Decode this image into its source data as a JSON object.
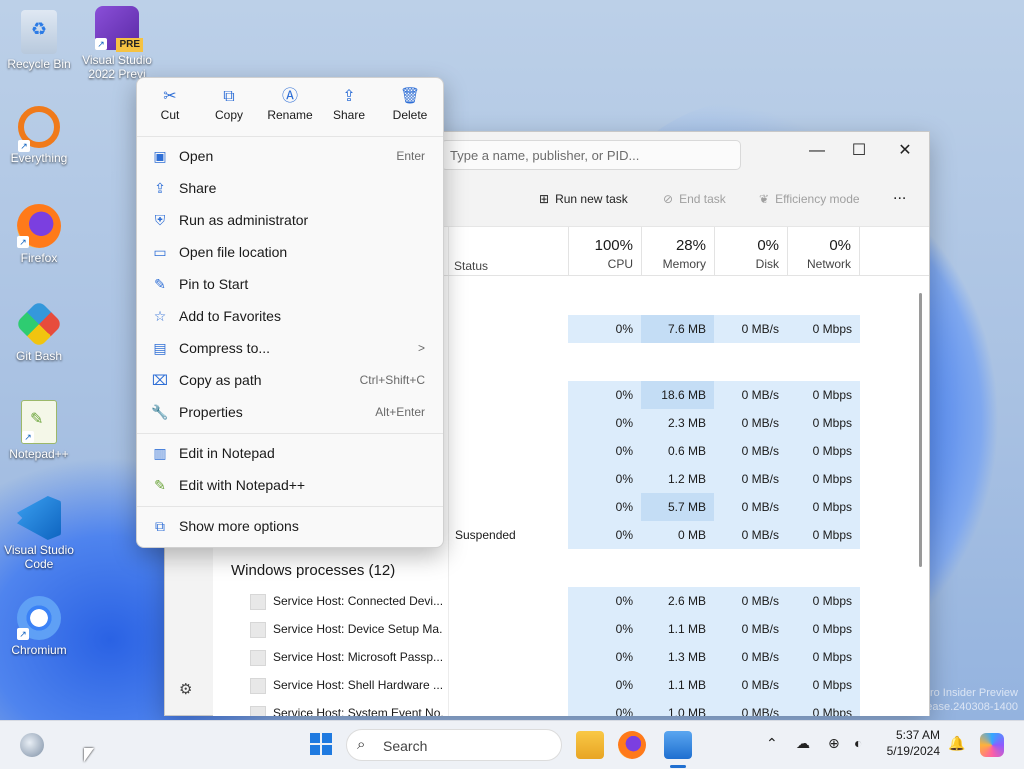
{
  "desktop": {
    "icons": [
      {
        "label": "Recycle Bin"
      },
      {
        "label": "Visual Studio 2022 Previ",
        "badge": "PRE"
      },
      {
        "label": "Everything"
      },
      {
        "label": "Firefox"
      },
      {
        "label": "Git Bash"
      },
      {
        "label": "Notepad++"
      },
      {
        "label": "Visual Studio Code"
      },
      {
        "label": "Chromium"
      }
    ],
    "watermark_line1": "ro Insider Preview",
    "watermark_line2": "ease.240308-1400"
  },
  "context_menu": {
    "actions": [
      {
        "label": "Cut",
        "icon": "cut-icon"
      },
      {
        "label": "Copy",
        "icon": "copy-icon"
      },
      {
        "label": "Rename",
        "icon": "rename-icon"
      },
      {
        "label": "Share",
        "icon": "share-icon"
      },
      {
        "label": "Delete",
        "icon": "delete-icon"
      }
    ],
    "items": [
      {
        "label": "Open",
        "shortcut": "Enter"
      },
      {
        "label": "Share",
        "shortcut": ""
      },
      {
        "label": "Run as administrator",
        "shortcut": ""
      },
      {
        "label": "Open file location",
        "shortcut": ""
      },
      {
        "label": "Pin to Start",
        "shortcut": ""
      },
      {
        "label": "Add to Favorites",
        "shortcut": ""
      },
      {
        "label": "Compress to...",
        "shortcut": ">"
      },
      {
        "label": "Copy as path",
        "shortcut": "Ctrl+Shift+C"
      },
      {
        "label": "Properties",
        "shortcut": "Alt+Enter"
      },
      {
        "label": "Edit in Notepad",
        "shortcut": ""
      },
      {
        "label": "Edit with Notepad++",
        "shortcut": ""
      },
      {
        "label": "Show more options",
        "shortcut": ""
      }
    ]
  },
  "task_manager": {
    "search_placeholder": "Type a name, publisher, or PID...",
    "toolbar": {
      "run_new_task": "Run new task",
      "end_task": "End task",
      "efficiency_mode": "Efficiency mode",
      "more": "..."
    },
    "columns": {
      "status": "Status",
      "cpu_pct": "100%",
      "cpu": "CPU",
      "mem_pct": "28%",
      "mem": "Memory",
      "disk_pct": "0%",
      "disk": "Disk",
      "net_pct": "0%",
      "net": "Network"
    },
    "rows_top": [
      {
        "cpu": "0%",
        "mem": "7.6 MB",
        "disk": "0 MB/s",
        "net": "0 Mbps",
        "hi": true
      },
      {
        "cpu": "0%",
        "mem": "18.6 MB",
        "disk": "0 MB/s",
        "net": "0 Mbps",
        "hi": true
      },
      {
        "cpu": "0%",
        "mem": "2.3 MB",
        "disk": "0 MB/s",
        "net": "0 Mbps",
        "hi": false
      },
      {
        "cpu": "0%",
        "mem": "0.6 MB",
        "disk": "0 MB/s",
        "net": "0 Mbps",
        "hi": false
      },
      {
        "cpu": "0%",
        "mem": "1.2 MB",
        "disk": "0 MB/s",
        "net": "0 Mbps",
        "hi": false
      },
      {
        "cpu": "0%",
        "mem": "5.7 MB",
        "disk": "0 MB/s",
        "net": "0 Mbps",
        "hi": true
      },
      {
        "cpu": "0%",
        "mem": "0 MB",
        "disk": "0 MB/s",
        "net": "0 Mbps",
        "hi": false,
        "status": "Suspended"
      }
    ],
    "group_title": "Windows processes (12)",
    "windows_processes": [
      {
        "name": "Service Host: Connected Devi...",
        "cpu": "0%",
        "mem": "2.6 MB",
        "disk": "0 MB/s",
        "net": "0 Mbps"
      },
      {
        "name": "Service Host: Device Setup Ma...",
        "cpu": "0%",
        "mem": "1.1 MB",
        "disk": "0 MB/s",
        "net": "0 Mbps"
      },
      {
        "name": "Service Host: Microsoft Passp...",
        "cpu": "0%",
        "mem": "1.3 MB",
        "disk": "0 MB/s",
        "net": "0 Mbps"
      },
      {
        "name": "Service Host: Shell Hardware ...",
        "cpu": "0%",
        "mem": "1.1 MB",
        "disk": "0 MB/s",
        "net": "0 Mbps"
      },
      {
        "name": "Service Host: System Event No...",
        "cpu": "0%",
        "mem": "1.0 MB",
        "disk": "0 MB/s",
        "net": "0 Mbps"
      }
    ]
  },
  "taskbar": {
    "search_label": "Search",
    "clock_time": "5:37 AM",
    "clock_date": "5/19/2024"
  }
}
